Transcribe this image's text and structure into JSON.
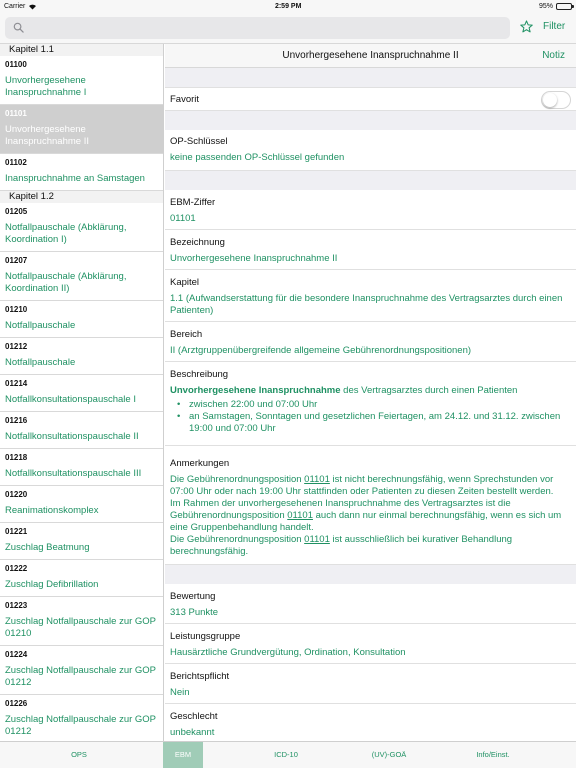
{
  "status_bar": {
    "carrier": "Carrier",
    "time": "2:59 PM",
    "battery": "95%",
    "battery_level": 0.95
  },
  "search": {
    "placeholder": "",
    "value": ""
  },
  "toolbar": {
    "filter_label": "Filter",
    "star_icon": "star-outline-icon"
  },
  "sidebar": {
    "sections": [
      {
        "header": "Kapitel 1.1",
        "items": [
          {
            "code": "01100",
            "title": "Unvorhergesehene Inanspruchnahme I",
            "selected": false
          },
          {
            "code": "01101",
            "title": "Unvorhergesehene Inanspruchnahme II",
            "selected": true
          },
          {
            "code": "01102",
            "title": "Inanspruchnahme an Samstagen",
            "selected": false
          }
        ]
      },
      {
        "header": "Kapitel 1.2",
        "items": [
          {
            "code": "01205",
            "title": "Notfallpauschale (Abklärung, Koordination I)",
            "selected": false
          },
          {
            "code": "01207",
            "title": "Notfallpauschale (Abklärung, Koordination II)",
            "selected": false
          },
          {
            "code": "01210",
            "title": "Notfallpauschale",
            "selected": false
          },
          {
            "code": "01212",
            "title": "Notfallpauschale",
            "selected": false
          },
          {
            "code": "01214",
            "title": "Notfallkonsultationspauschale I",
            "selected": false
          },
          {
            "code": "01216",
            "title": "Notfallkonsultationspauschale II",
            "selected": false
          },
          {
            "code": "01218",
            "title": "Notfallkonsultationspauschale III",
            "selected": false
          },
          {
            "code": "01220",
            "title": "Reanimationskomplex",
            "selected": false
          },
          {
            "code": "01221",
            "title": "Zuschlag Beatmung",
            "selected": false
          },
          {
            "code": "01222",
            "title": "Zuschlag Defibrillation",
            "selected": false
          },
          {
            "code": "01223",
            "title": "Zuschlag Notfallpauschale zur GOP 01210",
            "selected": false
          },
          {
            "code": "01224",
            "title": "Zuschlag Notfallpauschale zur GOP 01212",
            "selected": false
          },
          {
            "code": "01226",
            "title": "Zuschlag Notfallpauschale zur GOP 01212",
            "selected": false
          }
        ]
      }
    ]
  },
  "detail": {
    "title": "Unvorhergesehene Inanspruchnahme II",
    "notiz_label": "Notiz",
    "favorit": {
      "label": "Favorit",
      "on": false
    },
    "op_schluessel": {
      "label": "OP-Schlüssel",
      "value": "keine passenden OP-Schlüssel gefunden"
    },
    "ebm_ziffer": {
      "label": "EBM-Ziffer",
      "value": "01101"
    },
    "bezeichnung": {
      "label": "Bezeichnung",
      "value": "Unvorhergesehene Inanspruchnahme II"
    },
    "kapitel": {
      "label": "Kapitel",
      "value": "1.1 (Aufwandserstattung für die besondere Inanspruchnahme des Vertragsarztes durch einen Patienten)"
    },
    "bereich": {
      "label": "Bereich",
      "value": "II (Arztgruppenübergreifende allgemeine Gebührenordnungspositionen)"
    },
    "beschreibung": {
      "label": "Beschreibung",
      "bold": "Unvorhergesehene Inanspruchnahme",
      "rest": " des Vertragsarztes durch einen Patienten",
      "bullets": [
        "zwischen 22:00 und 07:00 Uhr",
        "an Samstagen, Sonntagen und gesetzlichen Feiertagen, am 24.12. und 31.12. zwischen 19:00 und 07:00 Uhr"
      ]
    },
    "anmerkungen": {
      "label": "Anmerkungen",
      "p1_a": "Die Gebührenordnungsposition ",
      "p1_ref": "01101",
      "p1_b": " ist nicht berechnungsfähig, wenn Sprechstunden vor 07:00 Uhr oder nach 19:00 Uhr stattfinden oder Patienten zu diesen Zeiten bestellt werden.",
      "p2_a": "Im Rahmen der unvorhergesehenen Inanspruchnahme des Vertragsarztes ist die Gebührenordnungsposition ",
      "p2_ref": "01101",
      "p2_b": " auch dann nur einmal berechnungsfähig, wenn es sich um eine Gruppenbehandlung handelt.",
      "p3_a": "Die Gebührenordnungsposition ",
      "p3_ref": "01101",
      "p3_b": " ist ausschließlich bei kurativer Behandlung berechnungsfähig."
    },
    "bewertung": {
      "label": "Bewertung",
      "value": "313 Punkte"
    },
    "leistungsgruppe": {
      "label": "Leistungsgruppe",
      "value": "Hausärztliche Grundvergütung, Ordination, Konsultation"
    },
    "berichtspflicht": {
      "label": "Berichtspflicht",
      "value": "Nein"
    },
    "geschlecht": {
      "label": "Geschlecht",
      "value": "unbekannt"
    }
  },
  "tabs": [
    {
      "label": "OPS",
      "active": false
    },
    {
      "label": "EBM",
      "active": true
    },
    {
      "label": "ICD-10",
      "active": false
    },
    {
      "label": "(UV)-GOÄ",
      "active": false
    },
    {
      "label": "Info/Einst.",
      "active": false
    }
  ],
  "colors": {
    "accent": "#1f9163",
    "selected_row": "#cfcfcf",
    "active_tab": "#a0ccb7"
  }
}
